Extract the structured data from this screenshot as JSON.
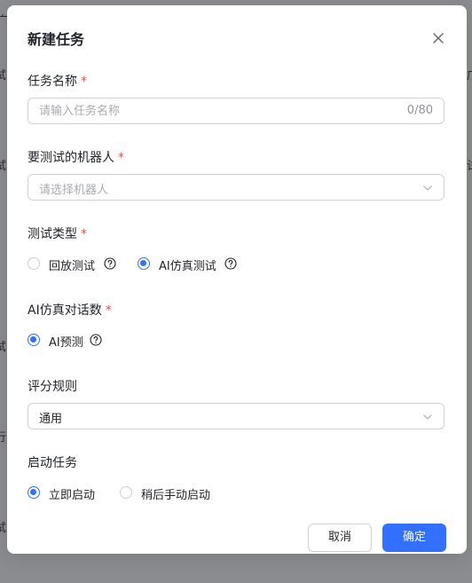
{
  "background": {
    "edge_fragments_left": [
      "广",
      "试",
      "试",
      "试",
      "行",
      "试"
    ],
    "edge_fragments_right": [
      "广",
      "试"
    ]
  },
  "dialog": {
    "title": "新建任务",
    "close_icon": "close-icon"
  },
  "form": {
    "task_name": {
      "label": "任务名称",
      "required_mark": "*",
      "placeholder": "请输入任务名称",
      "value": "",
      "counter": "0/80"
    },
    "robot": {
      "label": "要测试的机器人",
      "required_mark": "*",
      "placeholder": "请选择机器人"
    },
    "test_type": {
      "label": "测试类型",
      "required_mark": "*",
      "options": [
        {
          "label": "回放测试",
          "checked": false
        },
        {
          "label": "AI仿真测试",
          "checked": true
        }
      ]
    },
    "ai_turns": {
      "label": "AI仿真对话数",
      "required_mark": "*",
      "options": [
        {
          "label": "AI预测",
          "checked": true
        }
      ]
    },
    "scoring": {
      "label": "评分规则",
      "value": "通用"
    },
    "start": {
      "label": "启动任务",
      "options": [
        {
          "label": "立即启动",
          "checked": true
        },
        {
          "label": "稍后手动启动",
          "checked": false
        }
      ]
    }
  },
  "footer": {
    "cancel_label": "取消",
    "ok_label": "确定"
  },
  "colors": {
    "primary": "#3370ff",
    "required": "#f54a45",
    "overlay": "#8a8c90"
  }
}
